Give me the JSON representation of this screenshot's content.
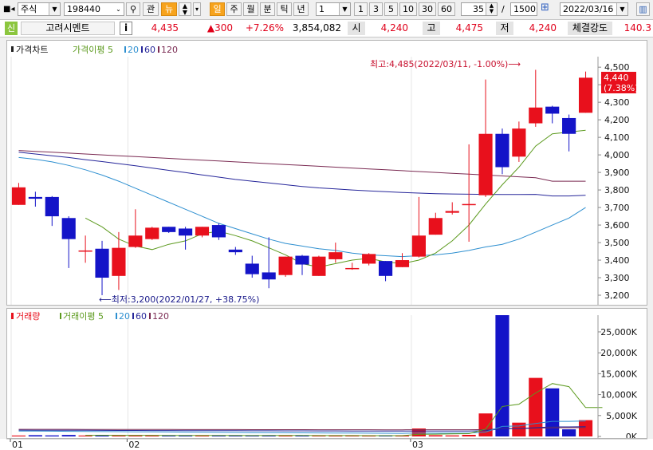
{
  "toolbar": {
    "market": "주식",
    "code": "198440",
    "btn_gwan": "관",
    "btn_new": "뉴",
    "btn_il": "일",
    "btn_ju": "주",
    "btn_wol": "월",
    "btn_bun": "분",
    "btn_tik": "틱",
    "btn_nyeon": "년",
    "period_value": "1",
    "period_btns": [
      "1",
      "3",
      "5",
      "10",
      "30",
      "60"
    ],
    "count_value": "35",
    "slash": "/",
    "total_value": "1500",
    "date_value": "2022/03/16"
  },
  "info": {
    "sin_tag": "신",
    "stock_name": "고려시멘트",
    "info_btn": "i",
    "price": "4,435",
    "change": "▲300",
    "change_pct": "+7.26%",
    "volume": "3,854,082",
    "open_label": "시",
    "open": "4,240",
    "high_label": "고",
    "high": "4,475",
    "low_label": "저",
    "low": "4,240",
    "strength_label": "체결강도",
    "strength": "140.3"
  },
  "price_chart": {
    "legend_title": "가격차트",
    "legend_ma_label": "가격이평",
    "legend_ma_periods": [
      "5",
      "20",
      "60",
      "120"
    ],
    "high_annotation": "최고:4,485(2022/03/11, -1.00%)",
    "low_annotation": "최저:3,200(2022/01/27, +38.75%)",
    "current_price_tag": "4,440",
    "current_pct_tag": "(7.38%)"
  },
  "volume_chart": {
    "legend_title": "거래량",
    "legend_ma_label": "거래이평",
    "legend_ma_periods": [
      "5",
      "20",
      "60",
      "120"
    ]
  },
  "colors": {
    "up": "#e8101c",
    "down": "#1414c8",
    "ma5": "#5c9a1e",
    "ma20": "#2d8fd0",
    "ma60": "#26269a",
    "ma120": "#7a2a52"
  },
  "chart_data": {
    "type": "candlestick",
    "x_labels": [
      "01",
      "02",
      "03"
    ],
    "price_ylim": [
      3150,
      4560
    ],
    "price_ticks": [
      3200,
      3300,
      3400,
      3500,
      3600,
      3700,
      3800,
      3900,
      4000,
      4100,
      4200,
      4300,
      4400,
      4500
    ],
    "price_tick_labels": [
      "3,200",
      "3,300",
      "3,400",
      "3,500",
      "3,600",
      "3,700",
      "3,800",
      "3,900",
      "4,000",
      "4,100",
      "4,200",
      "4,300",
      "4,400",
      "4,500"
    ],
    "candles": [
      {
        "o": 3715,
        "h": 3840,
        "l": 3715,
        "c": 3815
      },
      {
        "o": 3760,
        "h": 3790,
        "l": 3705,
        "c": 3750
      },
      {
        "o": 3760,
        "h": 3765,
        "l": 3595,
        "c": 3650
      },
      {
        "o": 3640,
        "h": 3650,
        "l": 3355,
        "c": 3520
      },
      {
        "o": 3455,
        "h": 3540,
        "l": 3385,
        "c": 3455
      },
      {
        "o": 3465,
        "h": 3510,
        "l": 3200,
        "c": 3300
      },
      {
        "o": 3310,
        "h": 3560,
        "l": 3230,
        "c": 3470
      },
      {
        "o": 3475,
        "h": 3690,
        "l": 3470,
        "c": 3540
      },
      {
        "o": 3520,
        "h": 3590,
        "l": 3515,
        "c": 3585
      },
      {
        "o": 3590,
        "h": 3590,
        "l": 3555,
        "c": 3560
      },
      {
        "o": 3580,
        "h": 3590,
        "l": 3460,
        "c": 3540
      },
      {
        "o": 3540,
        "h": 3590,
        "l": 3530,
        "c": 3590
      },
      {
        "o": 3600,
        "h": 3610,
        "l": 3515,
        "c": 3530
      },
      {
        "o": 3460,
        "h": 3475,
        "l": 3430,
        "c": 3445
      },
      {
        "o": 3380,
        "h": 3425,
        "l": 3300,
        "c": 3320
      },
      {
        "o": 3330,
        "h": 3530,
        "l": 3240,
        "c": 3290
      },
      {
        "o": 3315,
        "h": 3420,
        "l": 3305,
        "c": 3420
      },
      {
        "o": 3425,
        "h": 3430,
        "l": 3315,
        "c": 3375
      },
      {
        "o": 3310,
        "h": 3425,
        "l": 3310,
        "c": 3420
      },
      {
        "o": 3405,
        "h": 3500,
        "l": 3385,
        "c": 3445
      },
      {
        "o": 3355,
        "h": 3385,
        "l": 3345,
        "c": 3355
      },
      {
        "o": 3380,
        "h": 3440,
        "l": 3370,
        "c": 3435
      },
      {
        "o": 3395,
        "h": 3395,
        "l": 3280,
        "c": 3310
      },
      {
        "o": 3360,
        "h": 3440,
        "l": 3360,
        "c": 3400
      },
      {
        "o": 3420,
        "h": 3760,
        "l": 3415,
        "c": 3540
      },
      {
        "o": 3545,
        "h": 3670,
        "l": 3545,
        "c": 3640
      },
      {
        "o": 3670,
        "h": 3730,
        "l": 3660,
        "c": 3680
      },
      {
        "o": 3715,
        "h": 4060,
        "l": 3505,
        "c": 3720
      },
      {
        "o": 3770,
        "h": 4430,
        "l": 3760,
        "c": 4120
      },
      {
        "o": 4120,
        "h": 4150,
        "l": 3890,
        "c": 3930
      },
      {
        "o": 3990,
        "h": 4190,
        "l": 3960,
        "c": 4150
      },
      {
        "o": 4180,
        "h": 4485,
        "l": 4160,
        "c": 4270
      },
      {
        "o": 4275,
        "h": 4280,
        "l": 4180,
        "c": 4235
      },
      {
        "o": 4210,
        "h": 4230,
        "l": 4020,
        "c": 4120
      },
      {
        "o": 4240,
        "h": 4475,
        "l": 4240,
        "c": 4440
      }
    ],
    "ma5": [
      null,
      null,
      null,
      null,
      3640,
      3590,
      3520,
      3480,
      3460,
      3490,
      3510,
      3550,
      3565,
      3540,
      3510,
      3470,
      3430,
      3380,
      3360,
      3380,
      3400,
      3410,
      3390,
      3380,
      3400,
      3440,
      3510,
      3600,
      3720,
      3830,
      3930,
      4050,
      4120,
      4130,
      4140
    ],
    "ma20": [
      3985,
      3975,
      3960,
      3940,
      3915,
      3885,
      3850,
      3810,
      3770,
      3730,
      3690,
      3650,
      3610,
      3580,
      3550,
      3520,
      3495,
      3480,
      3465,
      3455,
      3440,
      3430,
      3425,
      3420,
      3425,
      3430,
      3440,
      3455,
      3475,
      3490,
      3520,
      3560,
      3600,
      3640,
      3700
    ],
    "ma60": [
      4015,
      4005,
      3995,
      3985,
      3973,
      3962,
      3950,
      3938,
      3925,
      3912,
      3899,
      3886,
      3873,
      3860,
      3850,
      3840,
      3830,
      3820,
      3812,
      3806,
      3800,
      3795,
      3790,
      3786,
      3782,
      3779,
      3777,
      3776,
      3775,
      3774,
      3774,
      3775,
      3766,
      3766,
      3770
    ],
    "ma120": [
      4025,
      4020,
      4015,
      4010,
      4005,
      4000,
      3995,
      3990,
      3985,
      3980,
      3975,
      3970,
      3965,
      3960,
      3955,
      3950,
      3945,
      3940,
      3935,
      3930,
      3925,
      3920,
      3915,
      3910,
      3905,
      3900,
      3895,
      3890,
      3885,
      3880,
      3875,
      3870,
      3850,
      3850,
      3850
    ],
    "volume_ylim": [
      0,
      29000
    ],
    "volume_ticks": [
      0,
      5000,
      10000,
      15000,
      20000,
      25000
    ],
    "volume_tick_labels": [
      "0K",
      "5,000K",
      "10,000K",
      "15,000K",
      "20,000K",
      "25,000K"
    ],
    "volumes": [
      220,
      300,
      250,
      350,
      220,
      280,
      250,
      260,
      240,
      220,
      210,
      230,
      200,
      210,
      200,
      260,
      190,
      210,
      220,
      180,
      200,
      180,
      210,
      180,
      1900,
      300,
      250,
      380,
      5500,
      29000,
      3300,
      14000,
      11500,
      1700,
      3900
    ],
    "vol_ma5": [
      null,
      null,
      null,
      null,
      270,
      280,
      270,
      270,
      260,
      250,
      240,
      240,
      230,
      220,
      210,
      220,
      220,
      220,
      210,
      210,
      210,
      200,
      200,
      190,
      530,
      560,
      620,
      670,
      1750,
      7150,
      7700,
      10400,
      12650,
      11900,
      6900,
      6900
    ],
    "vol_ma20": [
      1300,
      1280,
      1250,
      1220,
      1200,
      1170,
      1140,
      1110,
      1090,
      1060,
      1030,
      1000,
      970,
      950,
      920,
      900,
      880,
      860,
      840,
      820,
      800,
      780,
      760,
      740,
      800,
      790,
      780,
      790,
      1050,
      2400,
      2500,
      3100,
      3600,
      3600,
      3700
    ],
    "vol_ma60": [
      1500,
      1490,
      1480,
      1470,
      1460,
      1450,
      1440,
      1430,
      1420,
      1410,
      1400,
      1390,
      1380,
      1370,
      1360,
      1350,
      1340,
      1330,
      1320,
      1310,
      1300,
      1290,
      1280,
      1270,
      1300,
      1290,
      1290,
      1290,
      1380,
      1850,
      1880,
      2100,
      2280,
      2280,
      2340
    ],
    "vol_ma120": [
      1700,
      1700,
      1690,
      1690,
      1680,
      1680,
      1670,
      1670,
      1660,
      1660,
      1650,
      1650,
      1640,
      1640,
      1630,
      1630,
      1620,
      1620,
      1610,
      1610,
      1600,
      1600,
      1590,
      1590,
      1600,
      1600,
      1600,
      1600,
      1640,
      1870,
      1880,
      1990,
      2080,
      2080,
      2110
    ]
  }
}
